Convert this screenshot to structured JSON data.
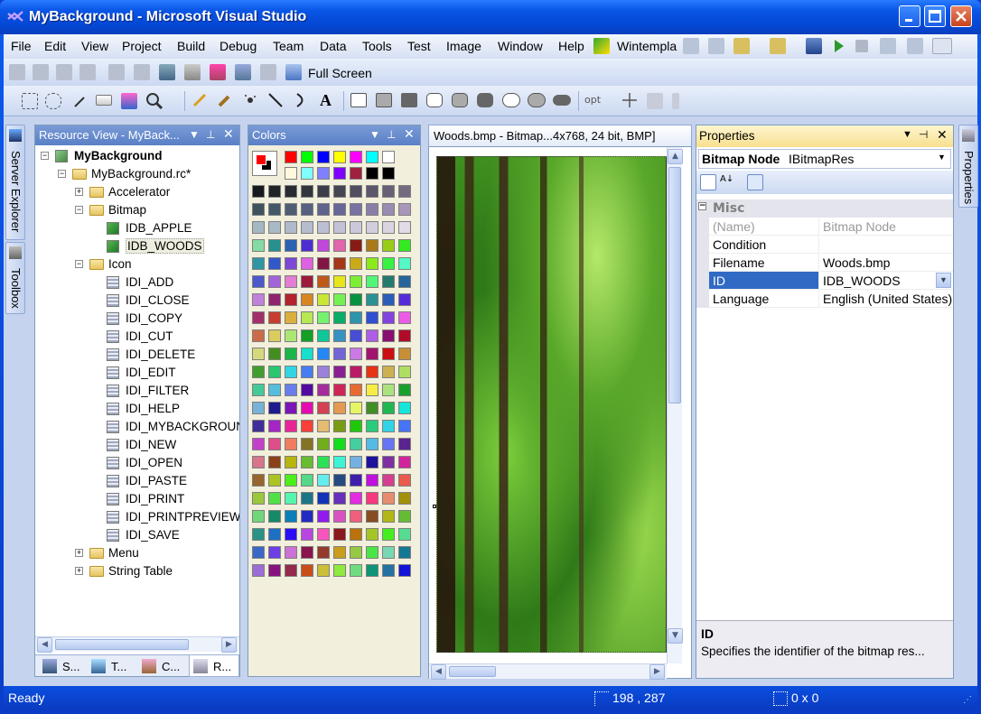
{
  "window": {
    "title": "MyBackground - Microsoft Visual Studio"
  },
  "menu": [
    "File",
    "Edit",
    "View",
    "Project",
    "Build",
    "Debug",
    "Team",
    "Data",
    "Tools",
    "Test",
    "Image",
    "Window",
    "Help"
  ],
  "toolbar": {
    "wintempla_label": "Wintempla",
    "fullscreen_label": "Full Screen",
    "opt_label": "opt"
  },
  "side_tabs": {
    "server_explorer": "Server Explorer",
    "toolbox": "Toolbox",
    "properties": "Properties"
  },
  "resource_view": {
    "title": "Resource View - MyBack...",
    "root": "MyBackground",
    "rc_file": "MyBackground.rc*",
    "folders": {
      "accelerator": "Accelerator",
      "bitmap": "Bitmap",
      "icon": "Icon",
      "menu": "Menu",
      "string_table": "String Table"
    },
    "bitmaps": [
      "IDB_APPLE",
      "IDB_WOODS"
    ],
    "icons": [
      "IDI_ADD",
      "IDI_CLOSE",
      "IDI_COPY",
      "IDI_CUT",
      "IDI_DELETE",
      "IDI_EDIT",
      "IDI_FILTER",
      "IDI_HELP",
      "IDI_MYBACKGROUND",
      "IDI_NEW",
      "IDI_OPEN",
      "IDI_PASTE",
      "IDI_PRINT",
      "IDI_PRINTPREVIEW",
      "IDI_SAVE"
    ],
    "bottom_tabs": [
      "S...",
      "T...",
      "C...",
      "R..."
    ]
  },
  "colors_panel": {
    "title": "Colors",
    "primary_color": "#ff0000",
    "secondary_color": "#000000",
    "top_swatches": [
      "#ff0000",
      "#00ff00",
      "#0000ff",
      "#ffff00",
      "#ff00ff",
      "#00ffff",
      "#ffffff",
      "#fff8dc",
      "#80ffff",
      "#8080ff",
      "#8000ff",
      "#a02040",
      "#000000",
      "#000000"
    ]
  },
  "document": {
    "tab_label": "Woods.bmp - Bitmap...4x768, 24 bit, BMP]"
  },
  "properties": {
    "title": "Properties",
    "object_name": "Bitmap Node",
    "object_type": "IBitmapRes",
    "category": "Misc",
    "rows": [
      {
        "name": "(Name)",
        "value": "Bitmap Node"
      },
      {
        "name": "Condition",
        "value": ""
      },
      {
        "name": "Filename",
        "value": "Woods.bmp"
      },
      {
        "name": "ID",
        "value": "IDB_WOODS"
      },
      {
        "name": "Language",
        "value": "English (United States)"
      }
    ],
    "desc_title": "ID",
    "desc_text": "Specifies the identifier of the bitmap res..."
  },
  "status": {
    "text": "Ready",
    "position": "198 , 287",
    "size": "0 x 0"
  }
}
